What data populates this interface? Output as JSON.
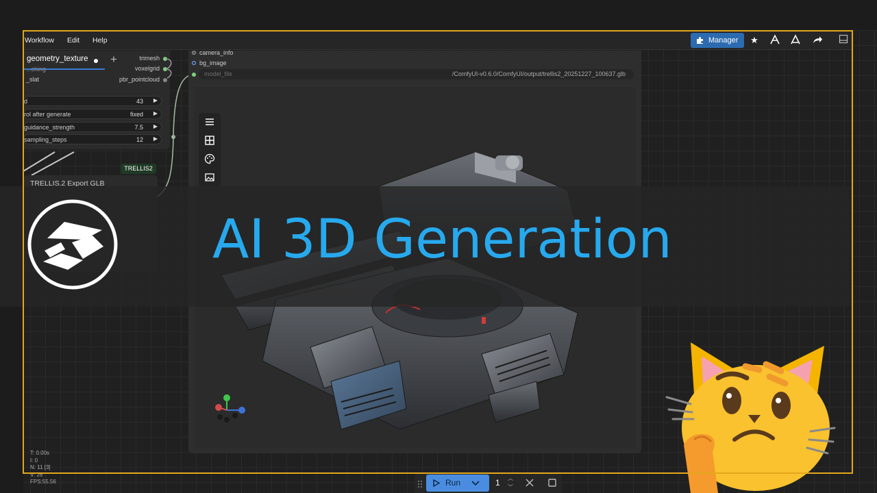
{
  "menu": {
    "workflow": "Workflow",
    "edit": "Edit",
    "help": "Help",
    "manager": "Manager"
  },
  "node_left": {
    "tab_title": "geometry_texture",
    "faint_label": "...ching",
    "input_slat": "_slat",
    "outputs": [
      "trimesh",
      "voxelgrid",
      "pbr_pointcloud"
    ],
    "widgets": [
      {
        "label": "d",
        "value": "43"
      },
      {
        "label": "rol after generate",
        "value": "fixed"
      },
      {
        "label": "guidance_strength",
        "value": "7.5"
      },
      {
        "label": "sampling_steps",
        "value": "12"
      }
    ]
  },
  "trellis_badge": "TRELLIS2",
  "export_node": {
    "title": "TRELLIS.2 Export GLB"
  },
  "preview_node": {
    "inputs": [
      "camera_info",
      "bg_image",
      "model_file"
    ],
    "model_path": "/ComfyUI-v0.6.0/ComfyUI/output/trellis2_20251227_100637.glb"
  },
  "overlay": {
    "title": "AI 3D Generation"
  },
  "stats": {
    "t": "T: 0.00s",
    "i": "I: 0",
    "n": "N: 11 [3]",
    "v": "V: 26",
    "fps": "FPS:55.56"
  },
  "runbar": {
    "run_label": "Run",
    "queue_count": "1"
  },
  "colors": {
    "accent_frame": "#e3a81b",
    "title_blue": "#27a9ee",
    "run_button": "#4a8de0",
    "manager_button": "#2d6bb0"
  }
}
